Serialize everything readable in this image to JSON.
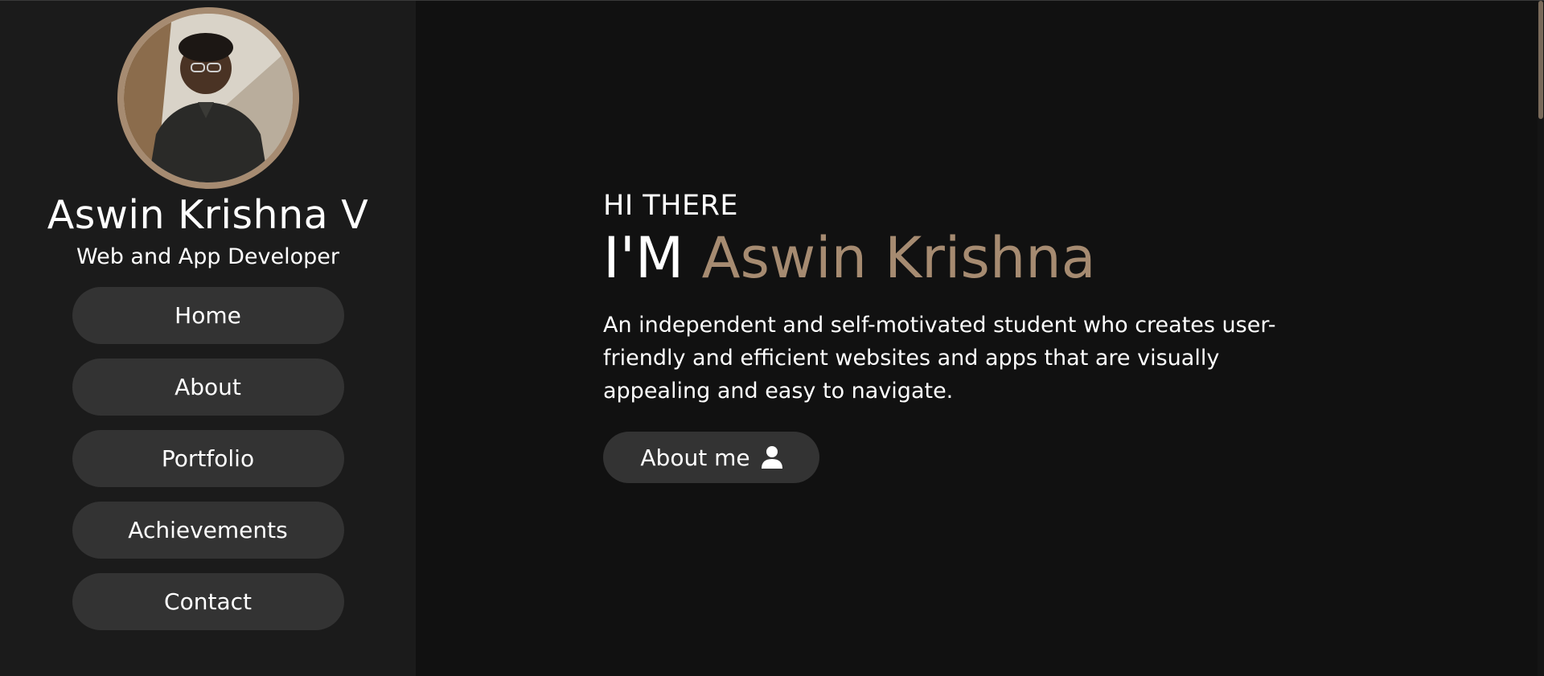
{
  "sidebar": {
    "avatar_icon": "profile-photo",
    "name": "Aswin Krishna V",
    "role": "Web and App Developer",
    "nav": [
      {
        "label": "Home"
      },
      {
        "label": "About"
      },
      {
        "label": "Portfolio"
      },
      {
        "label": "Achievements"
      },
      {
        "label": "Contact"
      }
    ]
  },
  "hero": {
    "greeting": "HI THERE",
    "headline_lead": "I'M",
    "headline_name": "Aswin Krishna",
    "description": "An independent and self-motivated student who creates user-friendly and efficient websites and apps that are visually appealing and easy to navigate.",
    "cta_label": "About me",
    "cta_icon": "user-icon"
  },
  "colors": {
    "accent": "#a68b71",
    "sidebar_bg": "#1b1b1b",
    "main_bg": "#111111",
    "button_bg": "#333333"
  }
}
